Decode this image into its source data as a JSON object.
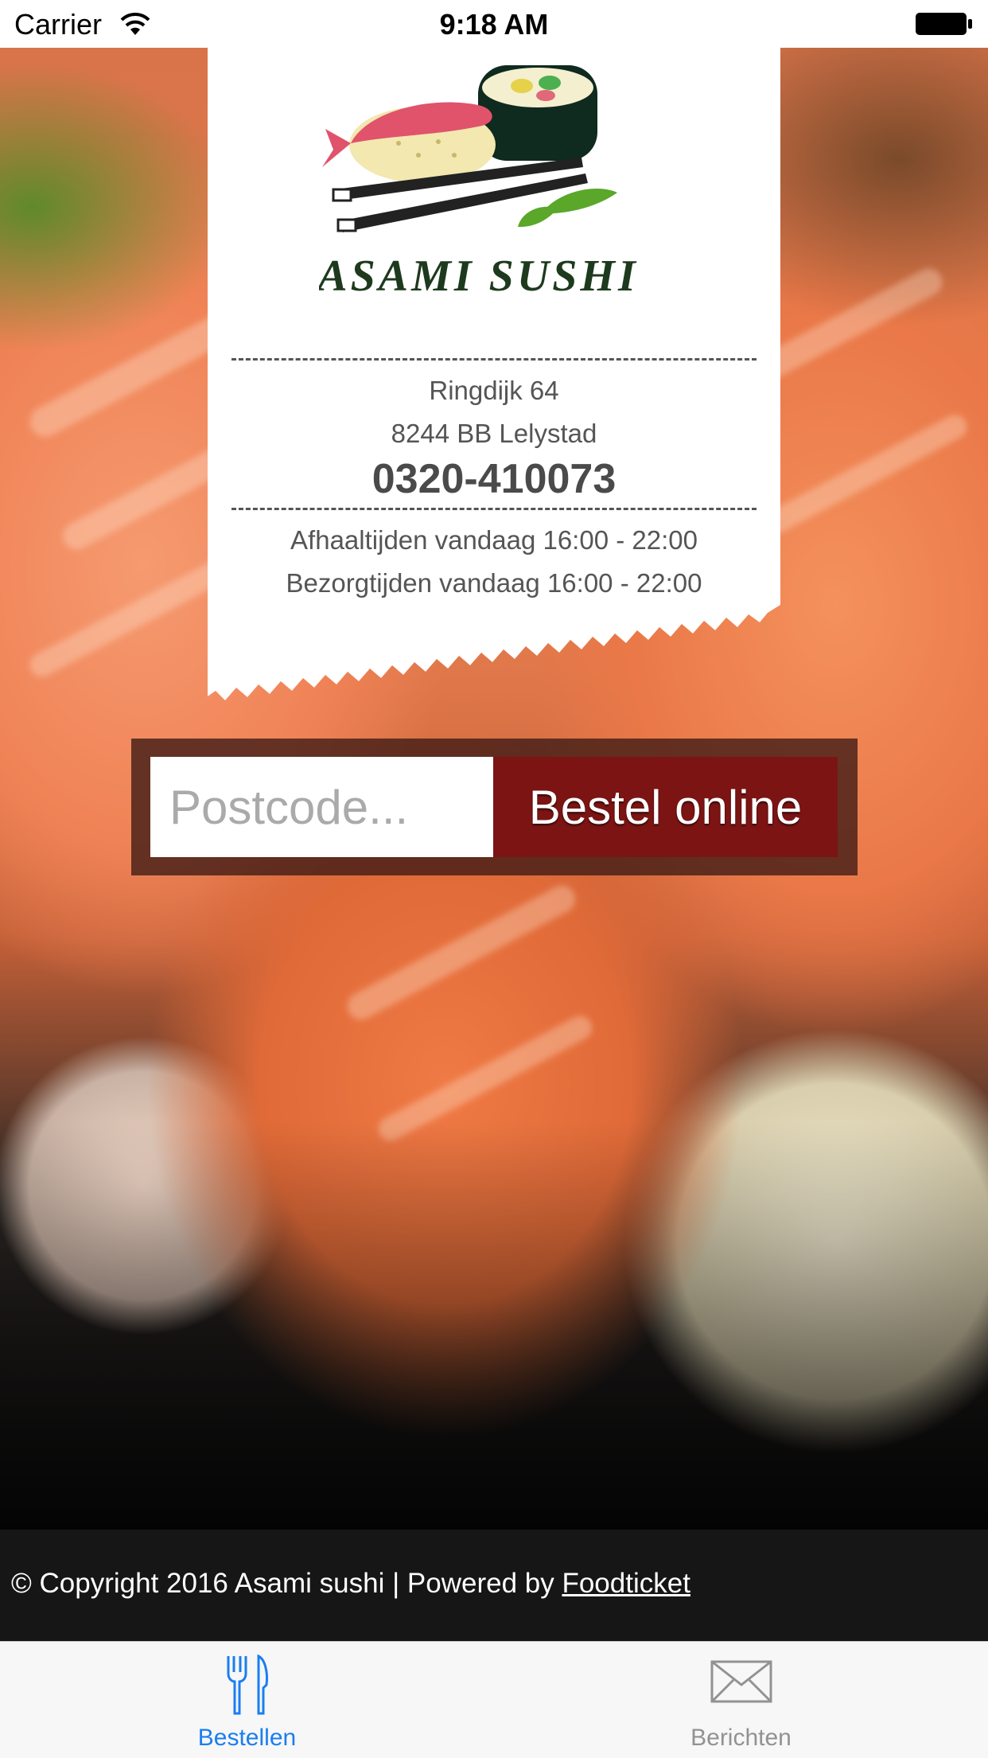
{
  "status_bar": {
    "carrier": "Carrier",
    "time": "9:18 AM",
    "icons": [
      "wifi-icon",
      "battery-icon"
    ]
  },
  "restaurant": {
    "logo_text": "Asami Sushi",
    "address_line1": "Ringdijk 64",
    "address_line2": "8244 BB Lelystad",
    "phone": "0320-410073",
    "pickup_hours": "Afhaaltijden vandaag 16:00 - 22:00",
    "delivery_hours": "Bezorgtijden vandaag 16:00 - 22:00"
  },
  "order": {
    "postcode_placeholder": "Postcode...",
    "postcode_value": "",
    "button_label": "Bestel online"
  },
  "footer": {
    "copyright": "© Copyright 2016 Asami sushi | Powered by ",
    "link_label": "Foodticket"
  },
  "tabs": [
    {
      "label": "Bestellen",
      "icon": "fork-knife-icon",
      "active": true
    },
    {
      "label": "Berichten",
      "icon": "envelope-icon",
      "active": false
    }
  ],
  "colors": {
    "accent": "#1a7ef0",
    "button": "#7c1414",
    "inactive_tab": "#929292"
  }
}
